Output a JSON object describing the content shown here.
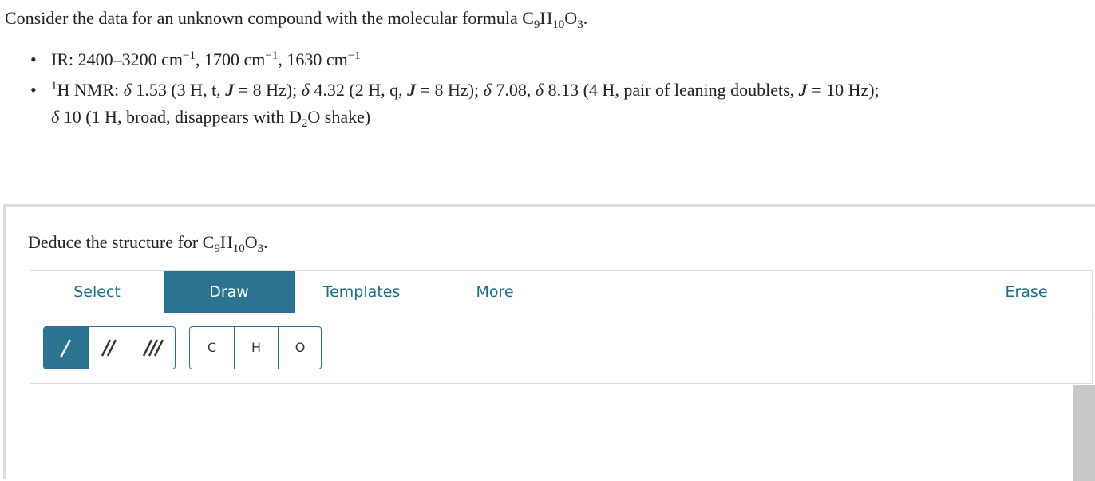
{
  "question": {
    "intro_prefix": "Consider the data for an unknown compound with the molecular formula C",
    "formula": {
      "C_sub": "9",
      "H": "H",
      "H_sub": "10",
      "O": "O",
      "O_sub": "3",
      "end": "."
    },
    "ir": {
      "label": "IR: 2400–3200 cm",
      "exp": "−1",
      "p2": ", 1700 cm",
      "p3": ", 1630 cm"
    },
    "nmr": {
      "sup": "1",
      "prefix": "H NMR: ",
      "s1": "δ",
      "t1": " 1.53 (3 H, t, ",
      "J": "J",
      "t1b": " = 8 Hz); ",
      "t2": " 4.32 (2 H, q, ",
      "t2b": " = 8 Hz); ",
      "t3": " 7.08, ",
      "t4": " 8.13 (4 H, pair of leaning doublets, ",
      "t4b": " = 10 Hz);",
      "t5": " 10 (1 H, broad, disappears with D",
      "d_sub": "2",
      "t5b": "O shake)"
    }
  },
  "task": {
    "prefix": "Deduce the structure for C",
    "end": "."
  },
  "toolbar": {
    "tabs": [
      {
        "label": "Select",
        "active": false
      },
      {
        "label": "Draw",
        "active": true
      },
      {
        "label": "Templates",
        "active": false
      },
      {
        "label": "More",
        "active": false
      }
    ],
    "erase_label": "Erase"
  },
  "tools": {
    "bonds": [
      "single-bond",
      "double-bond",
      "triple-bond"
    ],
    "atoms": [
      "C",
      "H",
      "O"
    ]
  },
  "colors": {
    "accent": "#2b7390",
    "tab_text": "#1b6e8a",
    "border": "#dcdcdc",
    "scrollbar": "#c8c8c8"
  }
}
